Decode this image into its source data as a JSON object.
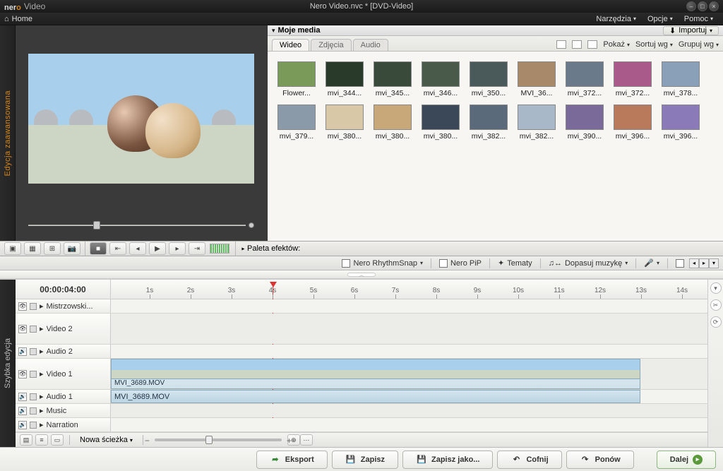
{
  "brand": {
    "name_prefix": "ner",
    "name_suffix": "o",
    "product": "Video"
  },
  "window_title": "Nero Video.nvc * [DVD-Video]",
  "menubar": {
    "home": "Home",
    "tools": "Narzędzia",
    "options": "Opcje",
    "help": "Pomoc"
  },
  "sidebar_left": {
    "advanced": "Edycja zaawansowana",
    "quick": "Szybka edycja"
  },
  "media": {
    "header": {
      "title": "Moje media",
      "import": "Importuj"
    },
    "tabs": {
      "video": "Wideo",
      "photos": "Zdjęcia",
      "audio": "Audio"
    },
    "tools": {
      "show": "Pokaż",
      "sort": "Sortuj wg",
      "group": "Grupuj wg"
    },
    "items": [
      {
        "label": "Flower..."
      },
      {
        "label": "mvi_344..."
      },
      {
        "label": "mvi_345..."
      },
      {
        "label": "mvi_346..."
      },
      {
        "label": "mvi_350..."
      },
      {
        "label": "MVI_36..."
      },
      {
        "label": "mvi_372..."
      },
      {
        "label": "mvi_372..."
      },
      {
        "label": "mvi_378..."
      },
      {
        "label": "mvi_379..."
      },
      {
        "label": "mvi_380..."
      },
      {
        "label": "mvi_380..."
      },
      {
        "label": "mvi_380..."
      },
      {
        "label": "mvi_382..."
      },
      {
        "label": "mvi_382..."
      },
      {
        "label": "mvi_390..."
      },
      {
        "label": "mvi_396..."
      },
      {
        "label": "mvi_396..."
      }
    ]
  },
  "effects_palette": "Paleta efektów:",
  "toolrow2": {
    "rhythm": "Nero RhythmSnap",
    "pip": "Nero PiP",
    "themes": "Tematy",
    "fit_music": "Dopasuj muzykę"
  },
  "timeline": {
    "timecode": "00:00:04:00",
    "ticks": [
      "1s",
      "2s",
      "3s",
      "4s",
      "5s",
      "6s",
      "7s",
      "8s",
      "9s",
      "10s",
      "11s",
      "12s",
      "13s",
      "14s"
    ],
    "tracks": {
      "master": "Mistrzowski...",
      "video2": "Video 2",
      "audio2": "Audio 2",
      "video1": "Video 1",
      "audio1": "Audio 1",
      "music": "Music",
      "narration": "Narration"
    },
    "clip_name": "MVI_3689.MOV",
    "audio_clip_name": "MVI_3689.MOV",
    "new_track": "Nowa ścieżka"
  },
  "actions": {
    "export": "Eksport",
    "save": "Zapisz",
    "save_as": "Zapisz jako...",
    "undo": "Cofnij",
    "redo": "Ponów",
    "next": "Dalej"
  }
}
